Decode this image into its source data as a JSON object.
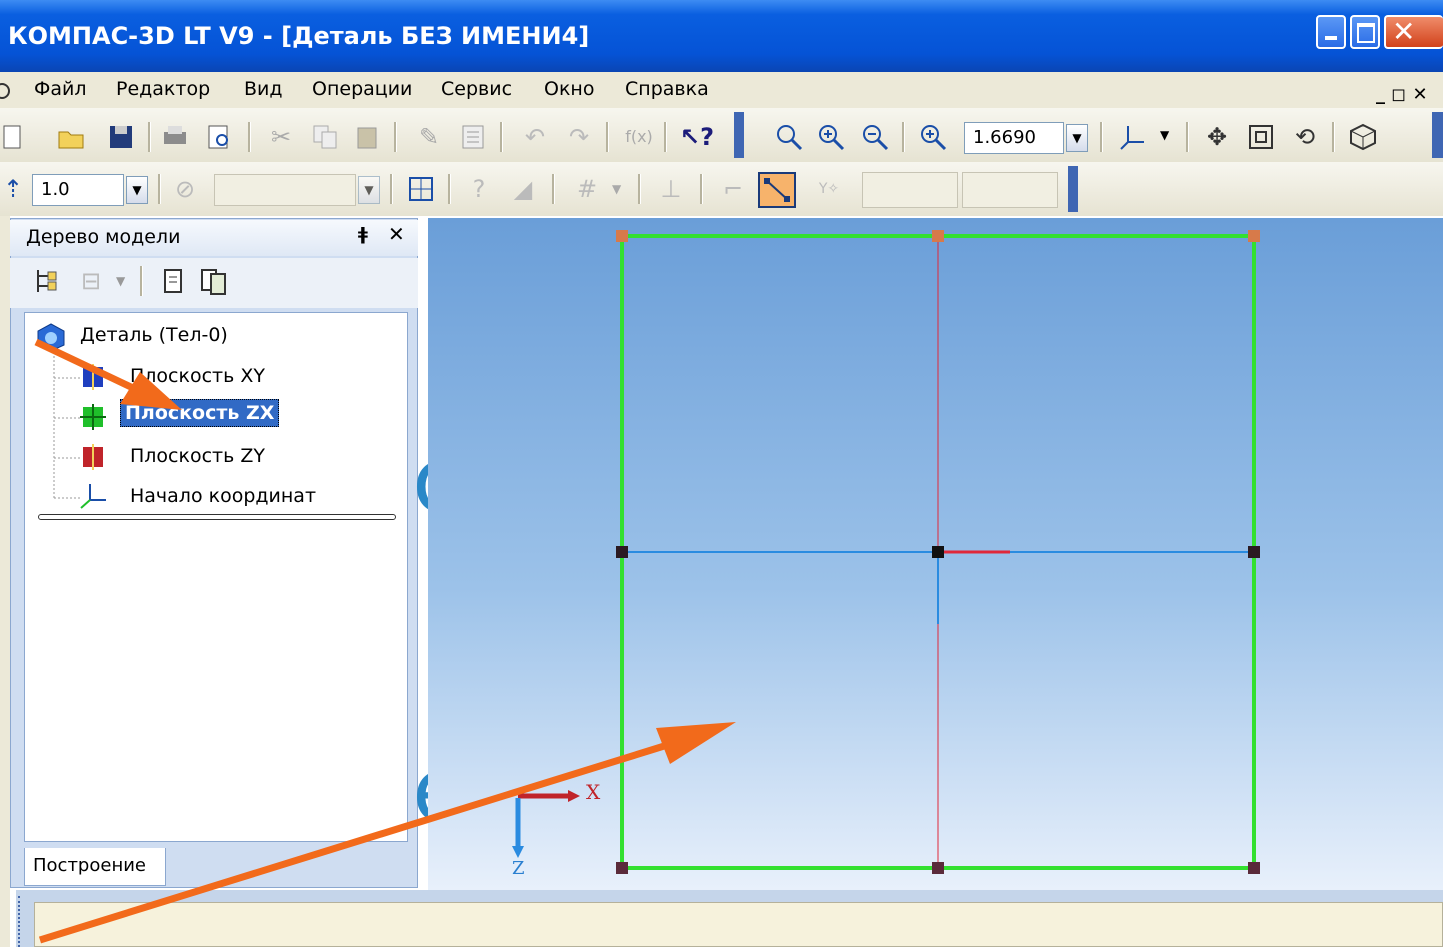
{
  "window": {
    "title": "КОМПАС-3D LT V9 - [Деталь БЕЗ ИМЕНИ4]"
  },
  "menu": {
    "items": [
      {
        "label": "Файл"
      },
      {
        "label": "Редактор"
      },
      {
        "label": "Вид"
      },
      {
        "label": "Операции"
      },
      {
        "label": "Сервис"
      },
      {
        "label": "Окно"
      },
      {
        "label": "Справка"
      }
    ],
    "mdi_controls": "_ ◻ ✕"
  },
  "toolbar": {
    "zoom_value": "1.6690",
    "line_width_value": "1.0",
    "layer_value": ""
  },
  "model_tree": {
    "title": "Дерево модели",
    "pin_icon_glyph": "ǂ",
    "close_glyph": "✕",
    "root": "Деталь (Тел-0)",
    "items": [
      {
        "label": "Плоскость XY",
        "color": "#1f3fbf"
      },
      {
        "label": "Плоскость ZX",
        "color": "#1fbf2a",
        "selected": true
      },
      {
        "label": "Плоскость ZY",
        "color": "#c0242a"
      },
      {
        "label": "Начало координат"
      }
    ],
    "tab_label": "Построение"
  },
  "viewport": {
    "axis_x_label": "X",
    "axis_z_label": "Z",
    "frame_color": "#33e02f",
    "axis_red": "#e0283a",
    "axis_blue": "#2a8be0",
    "arrow_color": "#f26a1b"
  },
  "background_letters": {
    "c": "c",
    "e": "e"
  }
}
